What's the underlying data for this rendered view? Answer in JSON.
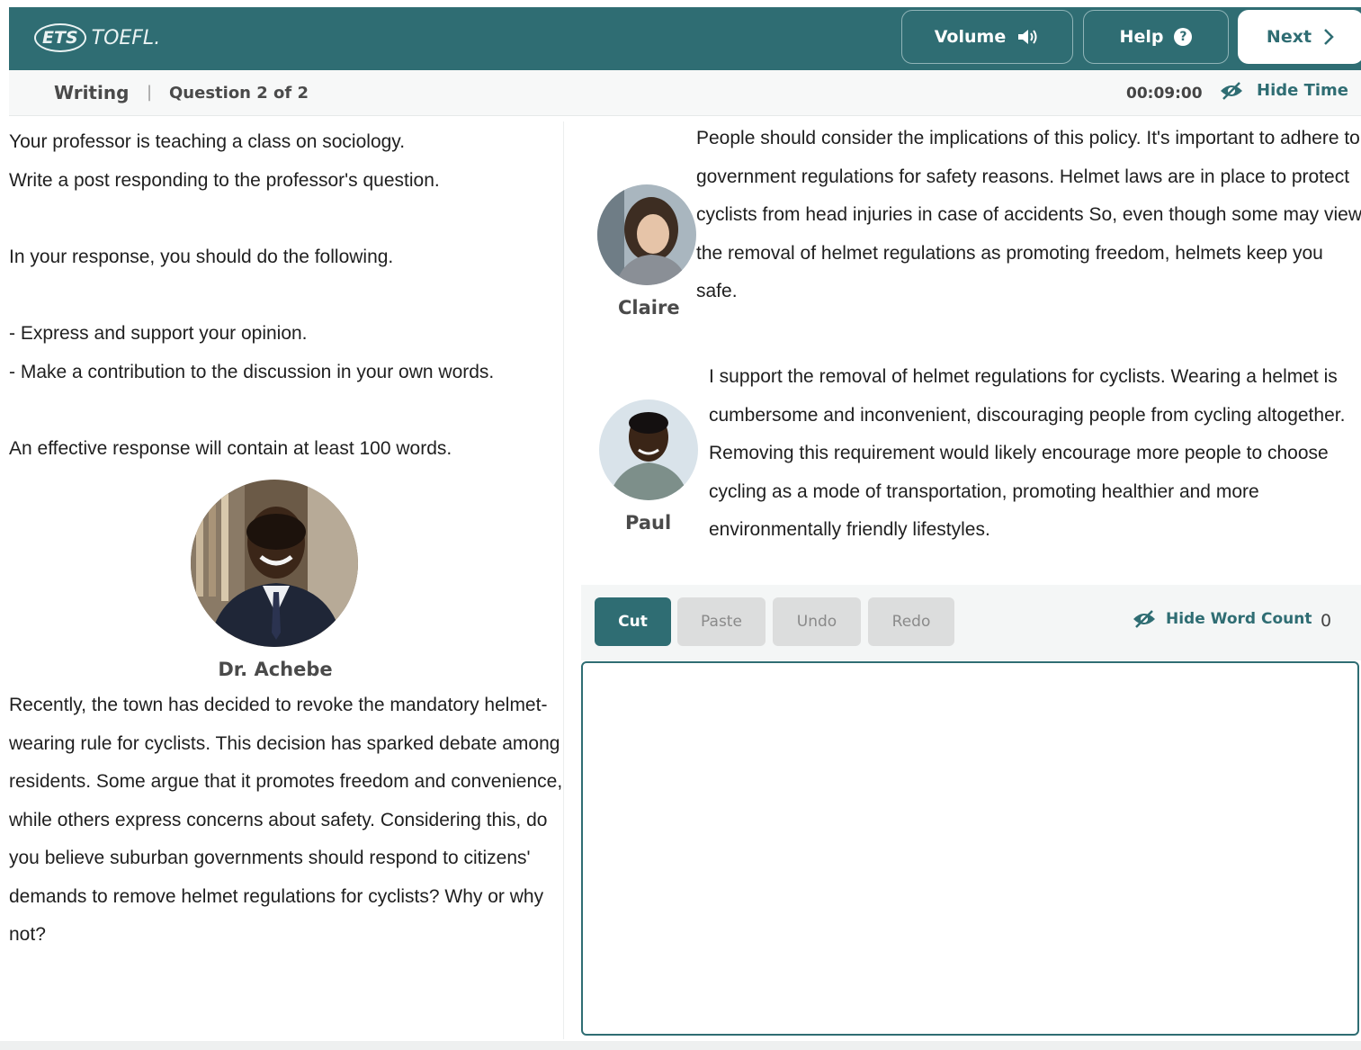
{
  "header": {
    "logo_ets": "ETS",
    "logo_product": "TOEFL.",
    "volume_label": "Volume",
    "help_label": "Help",
    "next_label": "Next"
  },
  "subbar": {
    "section": "Writing",
    "separator": "|",
    "question": "Question 2 of 2",
    "timer": "00:09:00",
    "hide_time_label": "Hide Time"
  },
  "prompt": {
    "lines": [
      "Your professor is teaching a class on sociology.",
      "Write a post responding to the professor's question.",
      "In your response, you should do the following.",
      "- Express and support your opinion.",
      "- Make a contribution to the discussion in your own words.",
      "An effective response will contain at least 100 words."
    ]
  },
  "professor": {
    "name": "Dr. Achebe",
    "question": "Recently, the town has decided to revoke the mandatory helmet-wearing rule for cyclists. This decision has sparked debate among residents. Some argue that it promotes freedom and convenience, while others express concerns about safety. Considering this, do you believe suburban governments should respond to citizens' demands to remove helmet regulations for cyclists? Why or why not?"
  },
  "posts": [
    {
      "name": "Claire",
      "text": "People should consider the implications of this policy. It's important to adhere to government regulations for safety reasons. Helmet laws are in place to protect cyclists from head injuries in case of accidents So, even though some may view the removal of helmet regulations as promoting freedom, helmets keep you safe."
    },
    {
      "name": "Paul",
      "text": "I support the removal of helmet regulations for cyclists. Wearing a helmet is cumbersome and inconvenient, discouraging people from cycling altogether. Removing this requirement would likely encourage more people to choose cycling as a mode of transportation, promoting healthier and more environmentally friendly lifestyles."
    }
  ],
  "editor": {
    "cut_label": "Cut",
    "paste_label": "Paste",
    "undo_label": "Undo",
    "redo_label": "Redo",
    "hide_word_count_label": "Hide Word Count",
    "word_count": "0",
    "response_value": ""
  },
  "colors": {
    "brand": "#2f6d73",
    "disabled_button": "#dcdddd"
  }
}
